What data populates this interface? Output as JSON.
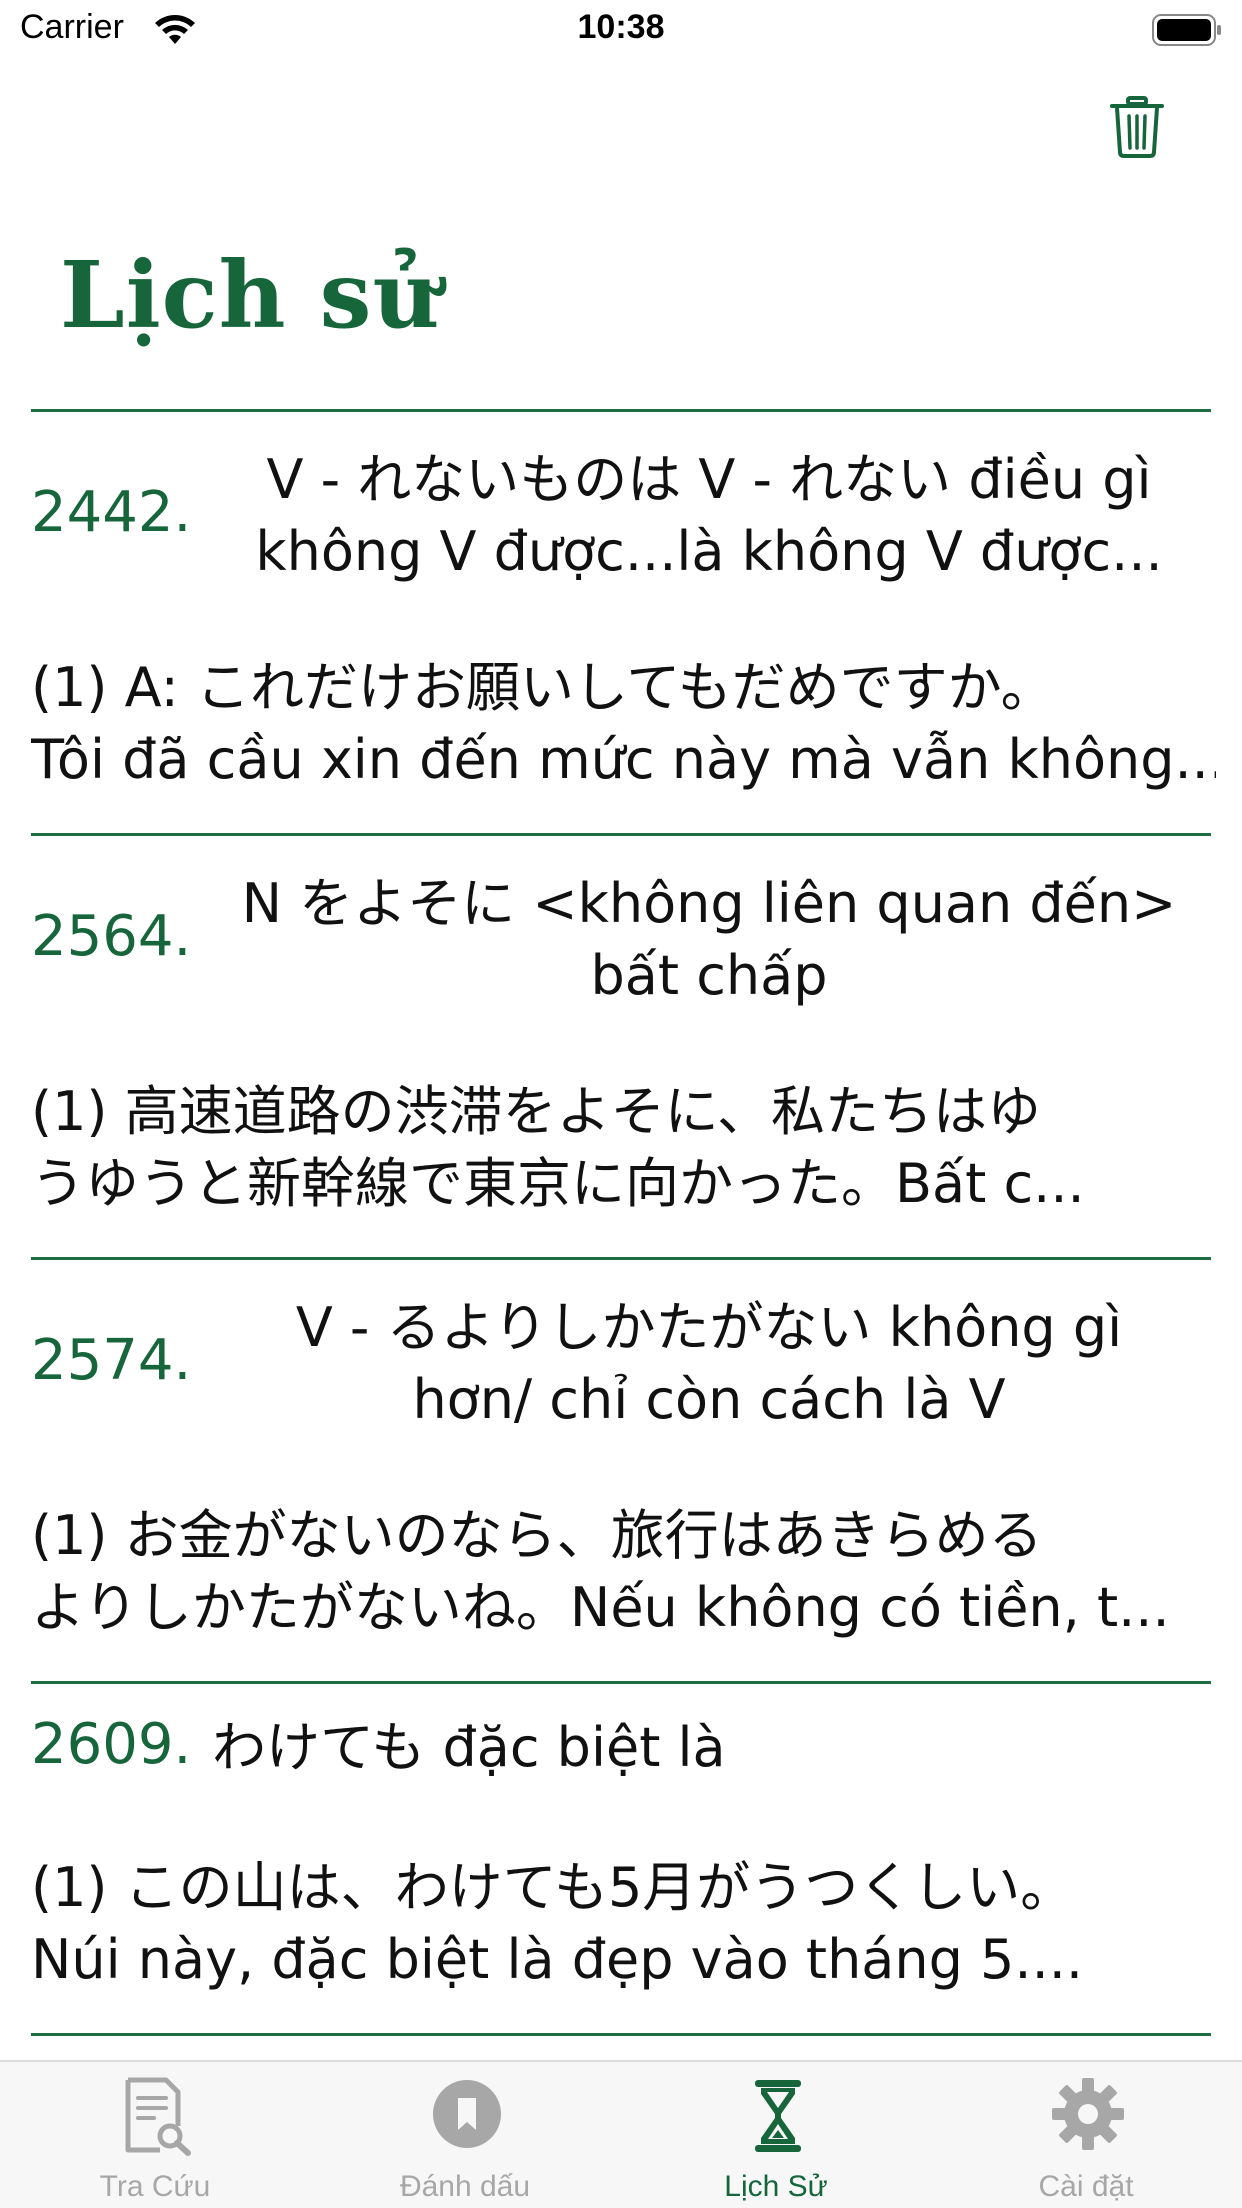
{
  "status_bar": {
    "carrier": "Carrier",
    "time": "10:38"
  },
  "header": {
    "title": "Lịch sử",
    "trash_icon": "trash-icon"
  },
  "colors": {
    "accent": "#16653b",
    "divider": "#1e6e44",
    "inactive_tab": "#a7a7a7"
  },
  "history": [
    {
      "number": "2442.",
      "title_line1": "V - れないものは V - れない điều gì",
      "title_line2": "không V được...là không V được...",
      "example_line1": "(1) A: これだけお願いしてもだめですか。",
      "example_line2": "Tôi đã cầu xin đến mức này mà vẫn không..."
    },
    {
      "number": "2564.",
      "title_line1": "N をよそに <không liên quan đến>",
      "title_line2": "bất chấp",
      "example_line1": "(1) 高速道路の渋滞をよそに、私たちはゆ",
      "example_line2": "うゆうと新幹線で東京に向かった。Bất c..."
    },
    {
      "number": "2574.",
      "title_line1": "V - るよりしかたがない không gì",
      "title_line2": "hơn/ chỉ còn cách là V",
      "example_line1": "(1) お金がないのなら、旅行はあきらめる",
      "example_line2": "よりしかたがないね。Nếu không có tiền, t..."
    },
    {
      "number": "2609.",
      "title_line1": "わけても đặc biệt là",
      "title_line2": "",
      "example_line1": "(1) この山は、わけても5月がうつくしい。",
      "example_line2": "Núi này, đặc biệt là đẹp vào tháng 5...."
    }
  ],
  "tabs": [
    {
      "label": "Tra Cứu",
      "icon": "search-document-icon",
      "active": false
    },
    {
      "label": "Đánh dấu",
      "icon": "bookmark-icon",
      "active": false
    },
    {
      "label": "Lịch Sử",
      "icon": "hourglass-icon",
      "active": true
    },
    {
      "label": "Cài đặt",
      "icon": "gear-icon",
      "active": false
    }
  ]
}
